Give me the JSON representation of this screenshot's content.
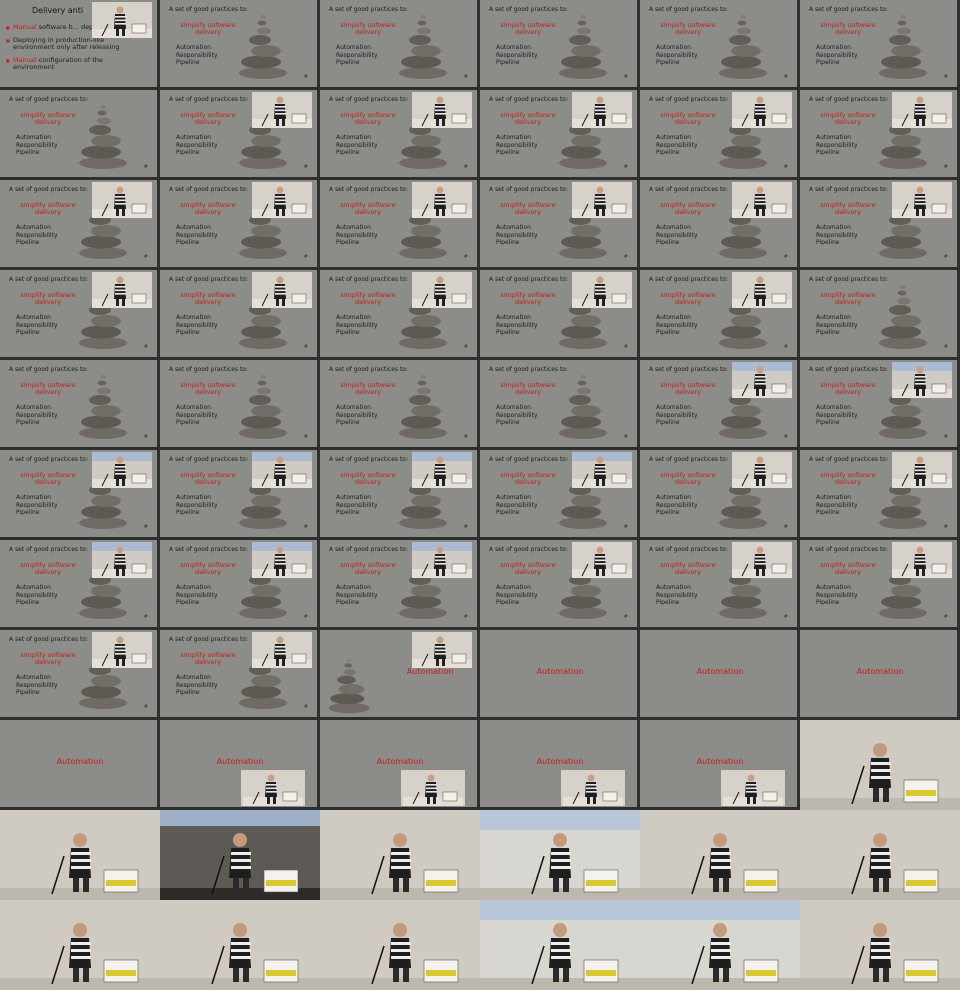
{
  "slide_texts": {
    "heading": "A set of good practices to:",
    "red_line_1": "simplify software",
    "red_line_2": "delivery",
    "list": [
      "Automation",
      "Responsibility",
      "Pipeline"
    ],
    "corner": "#"
  },
  "first_slide": {
    "title": "Delivery anti",
    "bullets": [
      {
        "red": "Manual",
        "rest": " software b... deployment"
      },
      {
        "red": "",
        "rest": "Deploying in production-like environment only after releasing"
      },
      {
        "red": "Manual",
        "rest": " configuration of the environment"
      }
    ]
  },
  "automation_label": "Automation",
  "colors": {
    "slide_bg": "#8c8c89",
    "red_text": "#c3201a",
    "dark_text": "#1d1d1d",
    "background": "#111111"
  },
  "tiles": [
    {
      "kind": "first",
      "inset": "plain"
    },
    {
      "kind": "slide",
      "inset": "none"
    },
    {
      "kind": "slide",
      "inset": "none"
    },
    {
      "kind": "slide",
      "inset": "none"
    },
    {
      "kind": "slide",
      "inset": "none"
    },
    {
      "kind": "slide",
      "inset": "none"
    },
    {
      "kind": "slide",
      "inset": "none"
    },
    {
      "kind": "slide",
      "inset": "plain"
    },
    {
      "kind": "slide",
      "inset": "plain"
    },
    {
      "kind": "slide",
      "inset": "plain"
    },
    {
      "kind": "slide",
      "inset": "plain"
    },
    {
      "kind": "slide",
      "inset": "plain"
    },
    {
      "kind": "slide",
      "inset": "plain"
    },
    {
      "kind": "slide",
      "inset": "plain"
    },
    {
      "kind": "slide",
      "inset": "plain"
    },
    {
      "kind": "slide",
      "inset": "plain"
    },
    {
      "kind": "slide",
      "inset": "plain"
    },
    {
      "kind": "slide",
      "inset": "plain"
    },
    {
      "kind": "slide",
      "inset": "plain"
    },
    {
      "kind": "slide",
      "inset": "plain"
    },
    {
      "kind": "slide",
      "inset": "plain"
    },
    {
      "kind": "slide",
      "inset": "plain"
    },
    {
      "kind": "slide",
      "inset": "plain"
    },
    {
      "kind": "slide",
      "inset": "none"
    },
    {
      "kind": "slide",
      "inset": "none"
    },
    {
      "kind": "slide",
      "inset": "none"
    },
    {
      "kind": "slide",
      "inset": "none"
    },
    {
      "kind": "slide",
      "inset": "none"
    },
    {
      "kind": "slide",
      "inset": "blue"
    },
    {
      "kind": "slide",
      "inset": "blue"
    },
    {
      "kind": "slide",
      "inset": "blue"
    },
    {
      "kind": "slide",
      "inset": "blue"
    },
    {
      "kind": "slide",
      "inset": "blue"
    },
    {
      "kind": "slide",
      "inset": "blue"
    },
    {
      "kind": "slide",
      "inset": "plain"
    },
    {
      "kind": "slide",
      "inset": "plain"
    },
    {
      "kind": "slide",
      "inset": "blue"
    },
    {
      "kind": "slide",
      "inset": "blue"
    },
    {
      "kind": "slide",
      "inset": "blue"
    },
    {
      "kind": "slide",
      "inset": "plain"
    },
    {
      "kind": "slide",
      "inset": "plain"
    },
    {
      "kind": "slide",
      "inset": "plain"
    },
    {
      "kind": "slide",
      "inset": "plain"
    },
    {
      "kind": "slide",
      "inset": "plain"
    },
    {
      "kind": "stones-only",
      "inset": "plain"
    },
    {
      "kind": "automation",
      "inset": "none"
    },
    {
      "kind": "automation",
      "inset": "none"
    },
    {
      "kind": "automation",
      "inset": "none"
    },
    {
      "kind": "automation",
      "inset": "none"
    },
    {
      "kind": "automation",
      "inset": "plain"
    },
    {
      "kind": "automation",
      "inset": "plain"
    },
    {
      "kind": "automation",
      "inset": "plain"
    },
    {
      "kind": "automation",
      "inset": "plain"
    },
    {
      "kind": "photo",
      "inset": "none"
    },
    {
      "kind": "photo",
      "inset": "none"
    },
    {
      "kind": "photo-dark",
      "inset": "none"
    },
    {
      "kind": "photo",
      "inset": "none"
    },
    {
      "kind": "photo-blue",
      "inset": "none"
    },
    {
      "kind": "photo",
      "inset": "none"
    },
    {
      "kind": "photo",
      "inset": "none"
    },
    {
      "kind": "photo",
      "inset": "none"
    },
    {
      "kind": "photo",
      "inset": "none"
    },
    {
      "kind": "photo",
      "inset": "none"
    },
    {
      "kind": "photo-blue",
      "inset": "none"
    },
    {
      "kind": "photo-blue",
      "inset": "none"
    },
    {
      "kind": "photo",
      "inset": "none"
    }
  ]
}
